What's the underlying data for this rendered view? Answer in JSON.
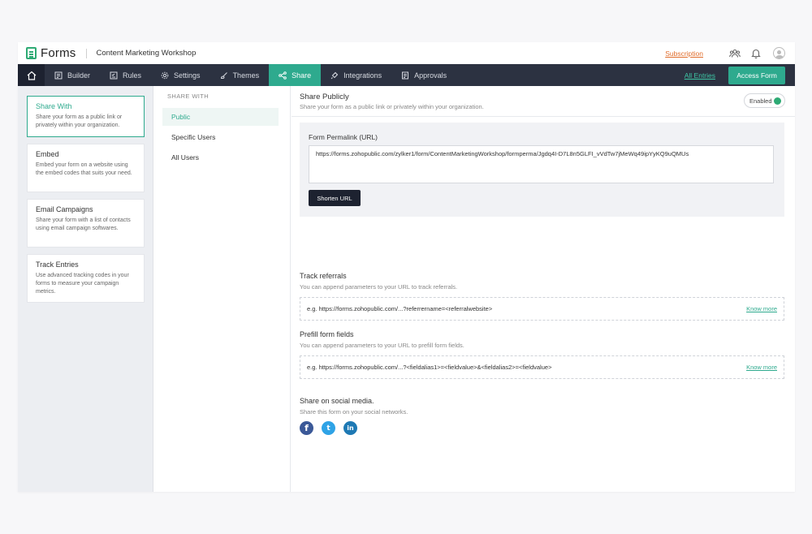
{
  "header": {
    "app_name": "Forms",
    "form_name": "Content Marketing Workshop",
    "subscription_label": "Subscription",
    "icons": [
      "team-icon",
      "bell-icon",
      "avatar"
    ]
  },
  "nav": {
    "home_icon": "home-icon",
    "items": [
      {
        "label": "Builder",
        "icon": "builder-icon"
      },
      {
        "label": "Rules",
        "icon": "rules-icon"
      },
      {
        "label": "Settings",
        "icon": "gear-icon"
      },
      {
        "label": "Themes",
        "icon": "brush-icon"
      },
      {
        "label": "Share",
        "icon": "share-icon",
        "active": true
      },
      {
        "label": "Integrations",
        "icon": "plug-icon"
      },
      {
        "label": "Approvals",
        "icon": "approvals-icon"
      }
    ],
    "all_entries_label": "All Entries",
    "access_form_label": "Access Form"
  },
  "left_panel": {
    "cards": [
      {
        "title": "Share With",
        "desc": "Share your form as a public link or privately within your organization.",
        "active": true
      },
      {
        "title": "Embed",
        "desc": "Embed your form on a website using the embed codes that suits your need."
      },
      {
        "title": "Email Campaigns",
        "desc": "Share your form with a list of contacts using email campaign softwares."
      },
      {
        "title": "Track Entries",
        "desc": "Use advanced tracking codes in your forms to measure your campaign metrics."
      }
    ]
  },
  "share_with": {
    "header": "SHARE WITH",
    "items": [
      {
        "label": "Public",
        "active": true
      },
      {
        "label": "Specific Users"
      },
      {
        "label": "All Users"
      }
    ]
  },
  "main": {
    "title": "Share Publicly",
    "subtitle": "Share your form as a public link or privately within your organization.",
    "enabled_label": "Enabled",
    "permalink": {
      "label": "Form Permalink (URL)",
      "url": "https://forms.zohopublic.com/zylker1/form/ContentMarketingWorkshop/formperma/Jgdq4I-D7L8n5GLFI_vVdTw7jMeWq49ipYyKQ9uQMUs",
      "shorten_label": "Shorten URL"
    },
    "track": {
      "title": "Track referrals",
      "subtitle": "You can append parameters to your URL to track referrals.",
      "example": "e.g. https://forms.zohopublic.com/...?referrername=<referralwebsite>",
      "know_more": "Know more"
    },
    "prefill": {
      "title": "Prefill form fields",
      "subtitle": "You can append parameters to your URL to prefill form fields.",
      "example": "e.g. https://forms.zohopublic.com/...?<fieldalias1>=<fieldvalue>&<fieldalias2>=<fieldvalue>",
      "know_more": "Know more"
    },
    "social": {
      "title": "Share on social media.",
      "subtitle": "Share this form on your social networks.",
      "networks": [
        {
          "name": "facebook-icon",
          "glyph": "f"
        },
        {
          "name": "twitter-icon",
          "glyph": "t"
        },
        {
          "name": "linkedin-icon",
          "glyph": "in"
        }
      ]
    }
  },
  "colors": {
    "accent": "#2eaa8e",
    "nav_bg": "#2c3241",
    "subscription": "#e06c2b"
  }
}
